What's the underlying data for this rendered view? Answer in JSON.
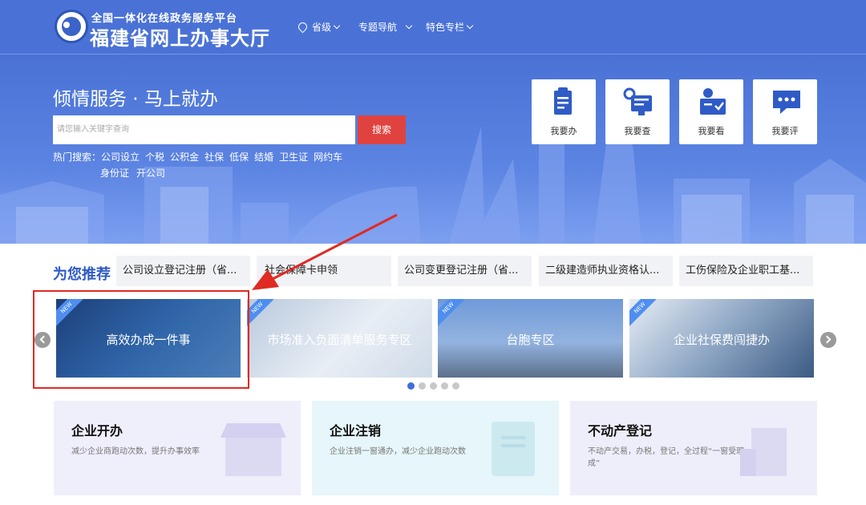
{
  "header": {
    "small_title": "全国一体化在线政务服务平台",
    "big_title": "福建省网上办事大厅",
    "nav": [
      {
        "label": "省级",
        "icon": "location-pin-icon"
      },
      {
        "label": "专题导航"
      },
      {
        "label": "特色专栏"
      }
    ]
  },
  "hero": {
    "tagline": "倾情服务 · 马上就办",
    "search_placeholder": "请您输入关键字查询",
    "search_button": "搜索",
    "hot_label": "热门搜索：",
    "hot_terms_row1": [
      "公司设立",
      "个税",
      "公积金",
      "社保",
      "低保",
      "结婚",
      "卫生证",
      "网约车"
    ],
    "hot_terms_row2": [
      "身份证",
      "开公司"
    ],
    "quick_actions": [
      {
        "label": "我要办",
        "icon": "clipboard-icon"
      },
      {
        "label": "我要查",
        "icon": "search-monitor-icon"
      },
      {
        "label": "我要看",
        "icon": "view-screen-icon"
      },
      {
        "label": "我要评",
        "icon": "comment-icon"
      }
    ]
  },
  "recommend": {
    "title": "为您推荐",
    "items": [
      "公司设立登记注册（省...",
      "社会保障卡申领",
      "公司变更登记注册（省...",
      "二级建造师执业资格认...",
      "工伤保险及企业职工基..."
    ]
  },
  "carousel": {
    "badge": "NEW",
    "cards": [
      "高效办成一件事",
      "市场准入负面清单服务专区",
      "台胞专区",
      "企业社保费闯捷办"
    ],
    "dots": 5,
    "active_dot": 0
  },
  "services": [
    {
      "title": "企业开办",
      "desc": "减少企业商跑动次数，提升办事效率",
      "bg": "#efeefb"
    },
    {
      "title": "企业注销",
      "desc": "企业注销一窗通办，减少企业跑动次数",
      "bg": "#e6f6fa"
    },
    {
      "title": "不动产登记",
      "desc": "不动产交易，办税，登记，全过程“一窗受理，一次办成”",
      "bg": "#eeeefb"
    }
  ],
  "colors": {
    "header_blue": "#4a72d6",
    "accent_red": "#e0433f",
    "title_blue": "#2f5bc6",
    "highlight_red": "#e02a24"
  }
}
